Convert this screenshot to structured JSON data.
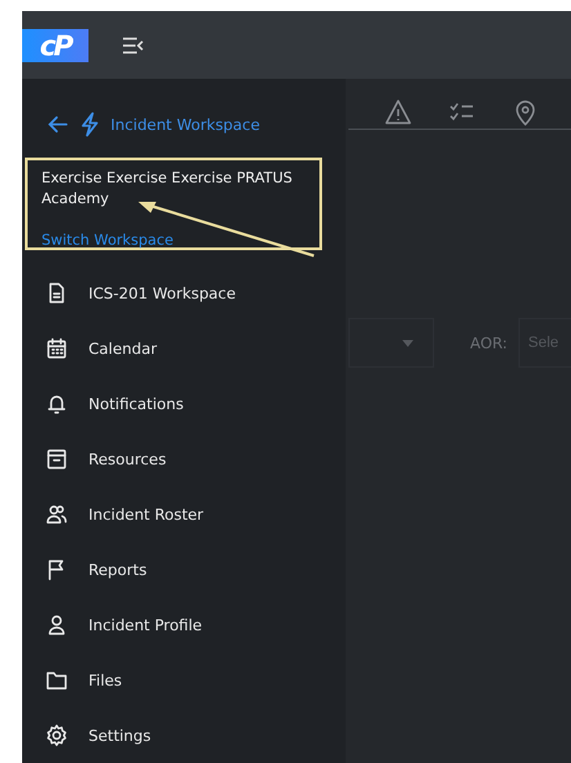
{
  "header": {
    "logo": "cP"
  },
  "workspace_nav": {
    "back_title": "Incident Workspace",
    "workspace_name": "Exercise Exercise Exercise PRATUS Academy",
    "switch_link": "Switch Workspace"
  },
  "menu": [
    {
      "label": "ICS-201 Workspace"
    },
    {
      "label": "Calendar"
    },
    {
      "label": "Notifications"
    },
    {
      "label": "Resources"
    },
    {
      "label": "Incident Roster"
    },
    {
      "label": "Reports"
    },
    {
      "label": "Incident Profile"
    },
    {
      "label": "Files"
    },
    {
      "label": "Settings"
    }
  ],
  "filters": {
    "aor_label": "AOR:",
    "aor_placeholder": "Sele"
  }
}
